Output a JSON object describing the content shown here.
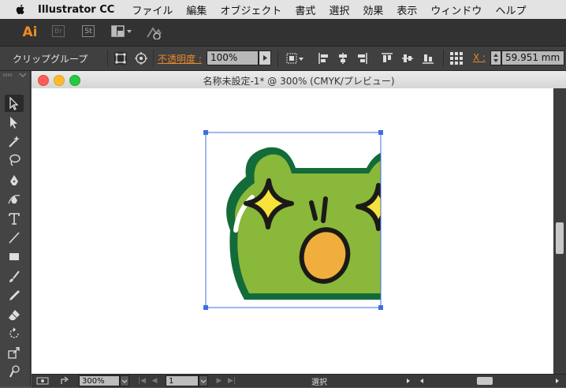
{
  "menubar": {
    "app_name": "Illustrator CC",
    "items": [
      "ファイル",
      "編集",
      "オブジェクト",
      "書式",
      "選択",
      "効果",
      "表示",
      "ウィンドウ",
      "ヘルプ"
    ]
  },
  "appbar": {
    "logo": "Ai",
    "bridge_badge": "Br",
    "stock_badge": "St"
  },
  "control_bar": {
    "selection_label": "クリップグループ",
    "opacity_label": "不透明度 :",
    "opacity_value": "100%",
    "x_label": "X :",
    "x_value": "59.951 mm"
  },
  "document": {
    "title": "名称未設定-1* @ 300% (CMYK/プレビュー)",
    "zoom": "300%",
    "artboard_number": "1",
    "status_text": "選択"
  },
  "colors": {
    "accent_orange": "#e8862b",
    "frog_green": "#8ab83a",
    "frog_outline": "#136b3a",
    "sparkle_yellow": "#f5e33b",
    "mouth_orange": "#f0ae3c",
    "selection_blue": "#3d6fe0"
  },
  "icons": {
    "tools": [
      "selection-tool-icon",
      "direct-selection-tool-icon",
      "magic-wand-tool-icon",
      "lasso-tool-icon",
      "pen-tool-icon",
      "curvature-tool-icon",
      "type-tool-icon",
      "line-tool-icon",
      "rectangle-tool-icon",
      "paintbrush-tool-icon",
      "pencil-tool-icon",
      "eraser-tool-icon",
      "rotate-tool-icon",
      "scale-tool-icon",
      "warp-tool-icon"
    ]
  }
}
